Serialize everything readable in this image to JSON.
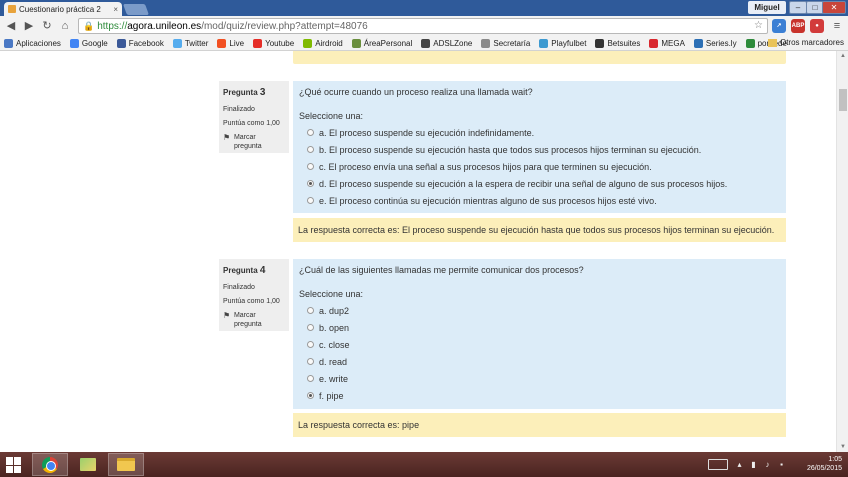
{
  "browser": {
    "tab_title": "Cuestionario práctica 2",
    "tab_close": "×",
    "user_name": "Miguel",
    "url_https": "https://",
    "url_host": "agora.unileon.es",
    "url_path": "/mod/quiz/review.php?attempt=48076",
    "extensions": [
      "ABP"
    ],
    "bookmarks": [
      {
        "label": "Aplicaciones",
        "icon": "apps-icon",
        "color": "#4a78c4"
      },
      {
        "label": "Google",
        "icon": "google-icon",
        "color": "#4285f4"
      },
      {
        "label": "Facebook",
        "icon": "facebook-icon",
        "color": "#3b5998"
      },
      {
        "label": "Twitter",
        "icon": "twitter-icon",
        "color": "#55acee"
      },
      {
        "label": "Live",
        "icon": "live-icon",
        "color": "#f25022"
      },
      {
        "label": "Youtube",
        "icon": "youtube-icon",
        "color": "#e52d27"
      },
      {
        "label": "Airdroid",
        "icon": "airdroid-icon",
        "color": "#7fba00"
      },
      {
        "label": "ÁreaPersonal",
        "icon": "area-icon",
        "color": "#6a8f3d"
      },
      {
        "label": "ADSLZone",
        "icon": "adslzone-icon",
        "color": "#444444"
      },
      {
        "label": "Secretaría",
        "icon": "secretaria-icon",
        "color": "#8a8a8a"
      },
      {
        "label": "Playfulbet",
        "icon": "playfulbet-icon",
        "color": "#3d9ad1"
      },
      {
        "label": "Betsuites",
        "icon": "betsuites-icon",
        "color": "#333333"
      },
      {
        "label": "MEGA",
        "icon": "mega-icon",
        "color": "#d9272e"
      },
      {
        "label": "Series.ly",
        "icon": "seriesly-icon",
        "color": "#2c6fb5"
      },
      {
        "label": "pordede",
        "icon": "pordede-icon",
        "color": "#2e8b3b"
      }
    ],
    "other_bookmarks": "Otros marcadores"
  },
  "quiz": {
    "questions": [
      {
        "label": "Pregunta",
        "number": "3",
        "state": "Finalizado",
        "points": "Puntúa como 1,00",
        "flag_label": "Marcar pregunta",
        "text": "¿Qué ocurre cuando un proceso realiza una llamada wait?",
        "prompt": "Seleccione una:",
        "options": [
          {
            "text": "a. El proceso suspende su ejecución indefinidamente.",
            "selected": false
          },
          {
            "text": "b. El proceso suspende su ejecución hasta que todos sus procesos hijos terminan su ejecución.",
            "selected": false
          },
          {
            "text": "c. El proceso envía una señal a sus procesos hijos para que terminen su ejecución.",
            "selected": false
          },
          {
            "text": "d. El proceso suspende su ejecución a la espera de recibir una señal de alguno de sus procesos hijos.",
            "selected": true
          },
          {
            "text": "e. El proceso continúa su ejecución mientras alguno de sus procesos hijos esté vivo.",
            "selected": false
          }
        ],
        "answer": "La respuesta correcta es: El proceso suspende su ejecución hasta que todos sus procesos hijos terminan su ejecución."
      },
      {
        "label": "Pregunta",
        "number": "4",
        "state": "Finalizado",
        "points": "Puntúa como 1,00",
        "flag_label": "Marcar pregunta",
        "text": "¿Cuál de las siguientes llamadas me permite comunicar dos procesos?",
        "prompt": "Seleccione una:",
        "options": [
          {
            "text": "a. dup2",
            "selected": false
          },
          {
            "text": "b. open",
            "selected": false
          },
          {
            "text": "c. close",
            "selected": false
          },
          {
            "text": "d. read",
            "selected": false
          },
          {
            "text": "e. write",
            "selected": false
          },
          {
            "text": "f. pipe",
            "selected": true
          }
        ],
        "answer": "La respuesta correcta es: pipe"
      }
    ]
  },
  "taskbar": {
    "time": "1:05",
    "date": "26/05/2015"
  }
}
